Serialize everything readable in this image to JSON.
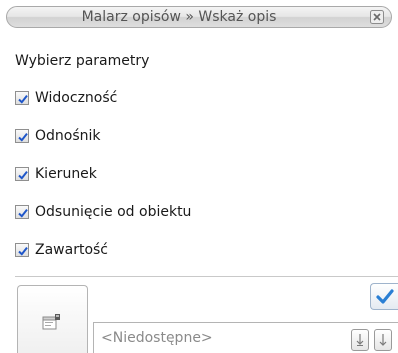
{
  "window": {
    "title": "Malarz opisów » Wskaż opis",
    "close_icon": "close-icon"
  },
  "panel": {
    "heading": "Wybierz parametry",
    "options": [
      {
        "label": "Widoczność",
        "checked": true
      },
      {
        "label": "Odnośnik",
        "checked": true
      },
      {
        "label": "Kierunek",
        "checked": true
      },
      {
        "label": "Odsunięcie od obiektu",
        "checked": true
      },
      {
        "label": "Zawartość",
        "checked": true
      }
    ]
  },
  "footer": {
    "settings_icon": "settings-window-icon",
    "ok_icon": "checkmark-icon",
    "combo_value": "<Niedostępne>",
    "tool_icons": [
      "pick-up-arrow-icon",
      "pick-down-arrow-icon"
    ]
  },
  "colors": {
    "checkmark": "#1e56c9",
    "ok_accent": "#2a7fd4",
    "title_text": "#555555",
    "disabled_text": "#8a8a8a"
  }
}
